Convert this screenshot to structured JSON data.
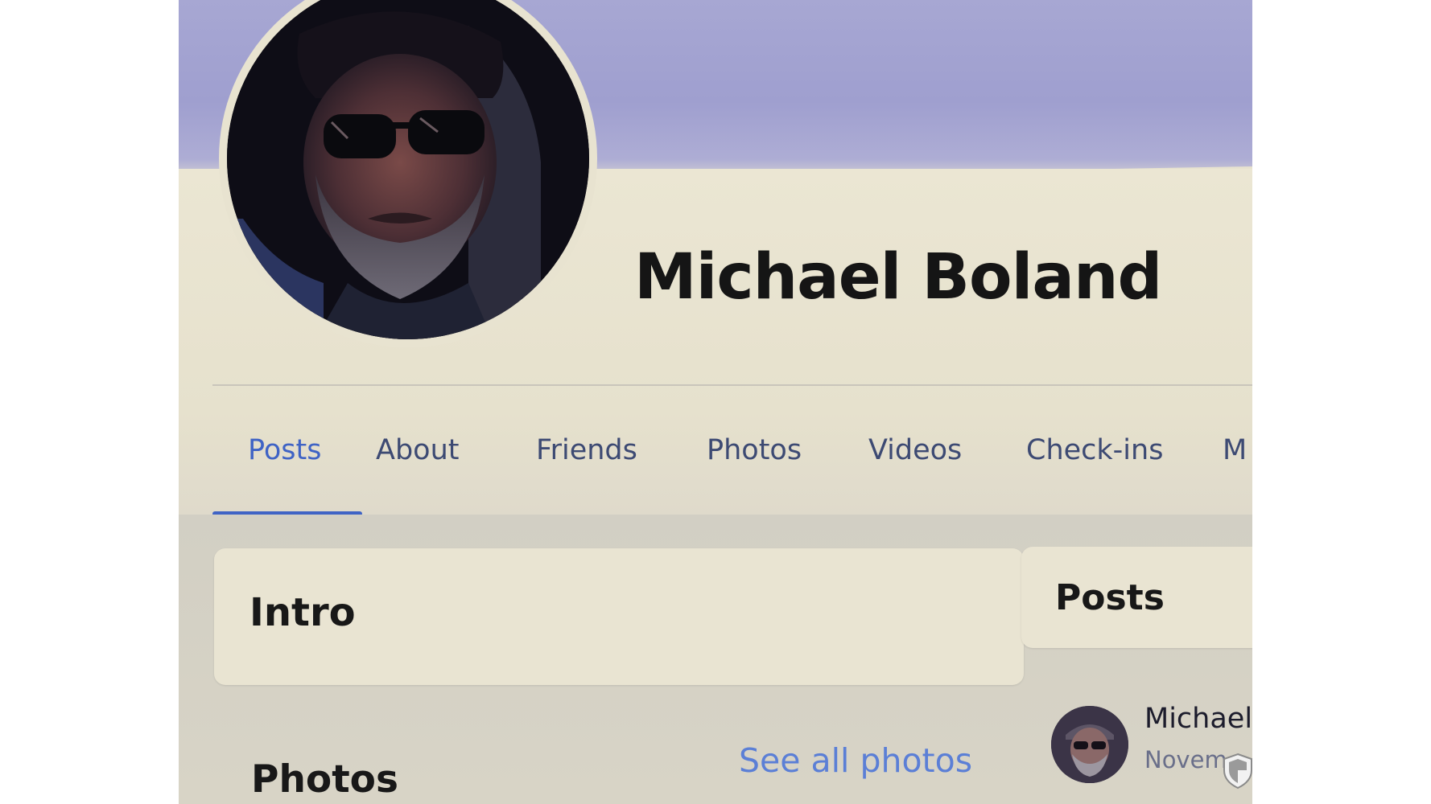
{
  "profile": {
    "name": "Michael Boland"
  },
  "tabs": [
    {
      "label": "Posts",
      "active": true
    },
    {
      "label": "About",
      "active": false
    },
    {
      "label": "Friends",
      "active": false
    },
    {
      "label": "Photos",
      "active": false
    },
    {
      "label": "Videos",
      "active": false
    },
    {
      "label": "Check-ins",
      "active": false
    },
    {
      "label": "M",
      "active": false
    }
  ],
  "intro": {
    "title": "Intro"
  },
  "photos": {
    "title": "Photos",
    "see_all_label": "See all photos"
  },
  "posts_panel": {
    "title": "Posts",
    "first_post": {
      "author": "Michael I",
      "date": "Novem"
    }
  },
  "icons": {
    "avatar": "profile-photo",
    "post_avatar": "profile-photo-small",
    "badge": "shield-icon"
  },
  "colors": {
    "accent": "#3f63c5",
    "link": "#5b7fd6",
    "tab_text": "#3d4a73",
    "cover": "#a7a7d3"
  }
}
